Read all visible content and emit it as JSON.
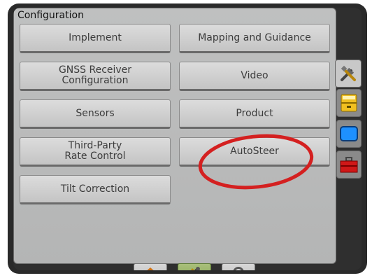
{
  "panel": {
    "title": "Configuration"
  },
  "buttons": {
    "implement": "Implement",
    "mapping": "Mapping and Guidance",
    "gnss_line1": "GNSS Receiver",
    "gnss_line2": "Configuration",
    "video": "Video",
    "sensors": "Sensors",
    "product": "Product",
    "third_line1": "Third-Party",
    "third_line2": "Rate Control",
    "autosteer": "AutoSteer",
    "tilt": "Tilt Correction"
  },
  "side_tabs": [
    {
      "icon": "tools-icon",
      "active": true
    },
    {
      "icon": "drawer-icon",
      "active": false
    },
    {
      "icon": "screen-icon",
      "active": false
    },
    {
      "icon": "toolbox-icon",
      "active": false
    }
  ],
  "bottom_tabs": [
    {
      "icon": "home-icon",
      "active": false
    },
    {
      "icon": "tools-icon",
      "active": true
    },
    {
      "icon": "camera-icon",
      "active": false
    }
  ],
  "colors": {
    "annotation": "#d42020",
    "active_tab": "#8aa65a"
  }
}
